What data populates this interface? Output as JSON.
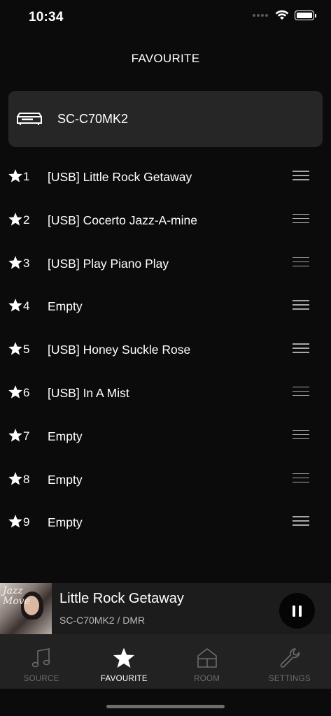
{
  "status_bar": {
    "time": "10:34"
  },
  "header": {
    "title": "FAVOURITE"
  },
  "device": {
    "name": "SC-C70MK2",
    "icon": "cd-receiver-icon"
  },
  "favourites": [
    {
      "number": "1",
      "title": "[USB] Little Rock Getaway"
    },
    {
      "number": "2",
      "title": "[USB] Cocerto Jazz-A-mine"
    },
    {
      "number": "3",
      "title": "[USB] Play Piano Play"
    },
    {
      "number": "4",
      "title": "Empty"
    },
    {
      "number": "5",
      "title": "[USB] Honey Suckle Rose"
    },
    {
      "number": "6",
      "title": "[USB] In A Mist"
    },
    {
      "number": "7",
      "title": "Empty"
    },
    {
      "number": "8",
      "title": "Empty"
    },
    {
      "number": "9",
      "title": "Empty"
    }
  ],
  "now_playing": {
    "title": "Little Rock Getaway",
    "subtitle": "SC-C70MK2 / DMR",
    "art_text": "Jazz Move"
  },
  "tabs": [
    {
      "label": "SOURCE",
      "icon": "music-note-icon",
      "active": false
    },
    {
      "label": "FAVOURITE",
      "icon": "star-icon",
      "active": true
    },
    {
      "label": "ROOM",
      "icon": "house-icon",
      "active": false
    },
    {
      "label": "SETTINGS",
      "icon": "wrench-icon",
      "active": false
    }
  ],
  "colors": {
    "background": "#0b0b0b",
    "card": "#262626",
    "tab_bar": "#222222",
    "inactive_tab": "#6c6c6c",
    "active_tab": "#ffffff"
  }
}
